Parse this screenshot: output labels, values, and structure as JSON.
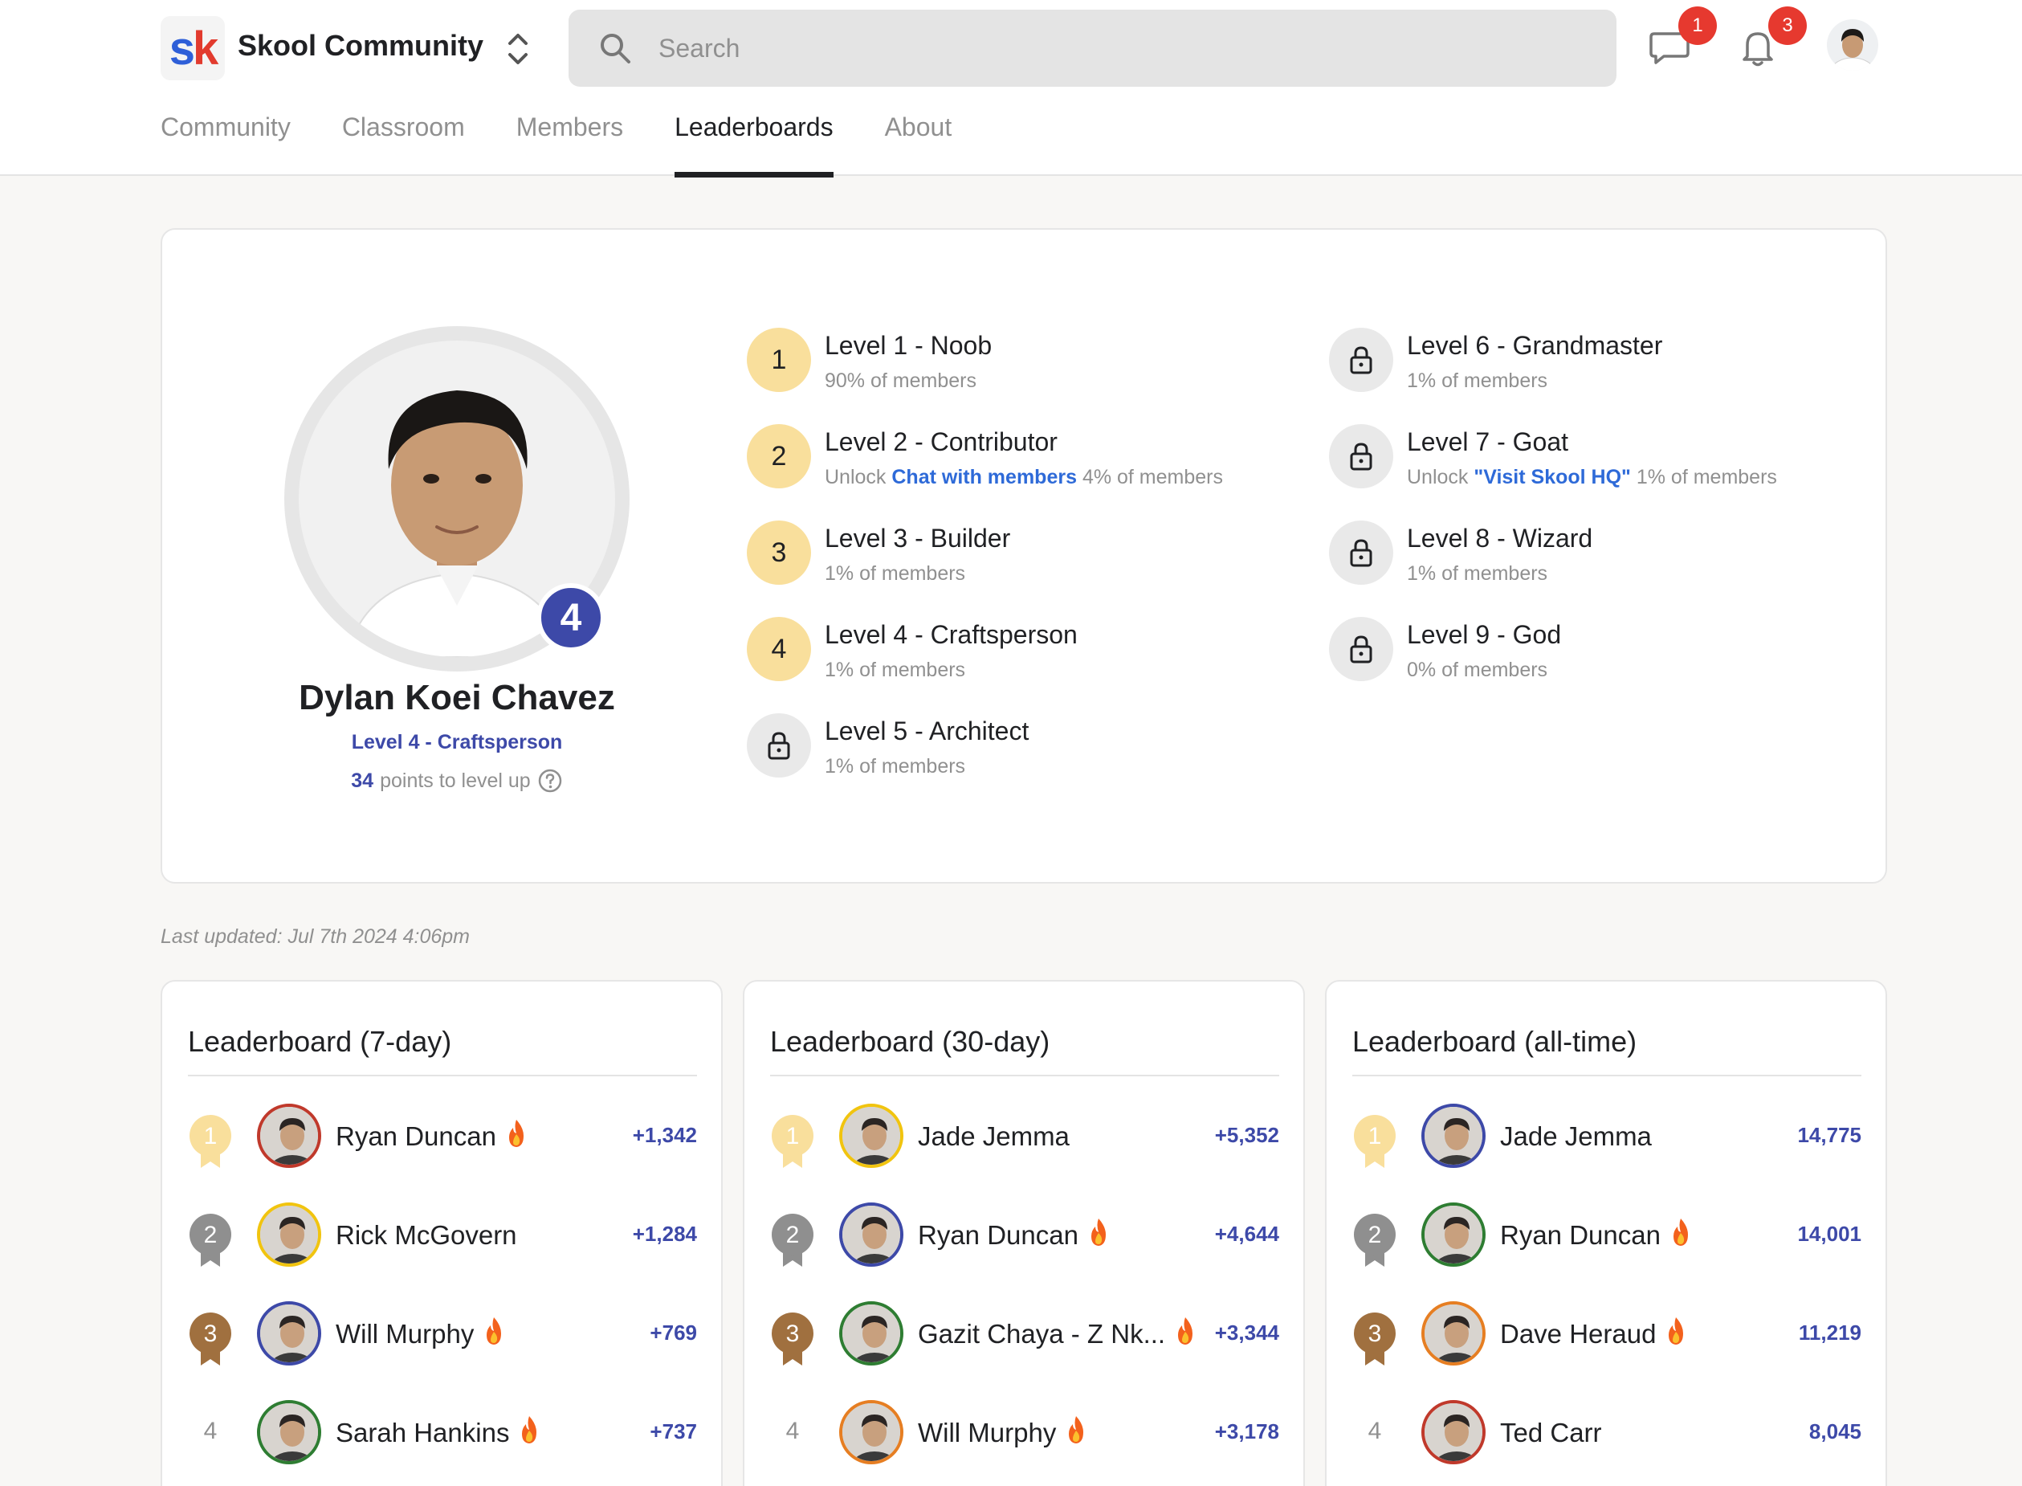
{
  "header": {
    "logo": {
      "s": "s",
      "k": "k"
    },
    "community_name": "Skool Community",
    "search_placeholder": "Search",
    "chat_badge": "1",
    "notif_badge": "3"
  },
  "tabs": [
    {
      "label": "Community"
    },
    {
      "label": "Classroom"
    },
    {
      "label": "Members"
    },
    {
      "label": "Leaderboards"
    },
    {
      "label": "About"
    }
  ],
  "profile": {
    "level_badge": "4",
    "name": "Dylan Koei Chavez",
    "level_name": "Level 4 - Craftsperson",
    "points": "34",
    "points_text": "points to level up"
  },
  "levels": [
    {
      "badge": "1",
      "title": "Level 1 - Noob",
      "sub": "90% of members"
    },
    {
      "badge": "2",
      "title": "Level 2 - Contributor",
      "unlock_prefix": "Unlock ",
      "unlock_link": "Chat with members",
      "sub": "4% of members"
    },
    {
      "badge": "3",
      "title": "Level 3 - Builder",
      "sub": "1% of members"
    },
    {
      "badge": "4",
      "title": "Level 4 - Craftsperson",
      "sub": "1% of members"
    },
    {
      "badge": "lock",
      "title": "Level 5 - Architect",
      "sub": "1% of members"
    },
    {
      "badge": "lock",
      "title": "Level 6 - Grandmaster",
      "sub": "1% of members"
    },
    {
      "badge": "lock",
      "title": "Level 7 - Goat",
      "unlock_prefix": "Unlock ",
      "unlock_link": "\"Visit Skool HQ\"",
      "sub": "1% of members"
    },
    {
      "badge": "lock",
      "title": "Level 8 - Wizard",
      "sub": "1% of members"
    },
    {
      "badge": "lock",
      "title": "Level 9 - God",
      "sub": "0% of members"
    }
  ],
  "last_updated": "Last updated: Jul 7th 2024 4:06pm",
  "leaderboards": [
    {
      "title": "Leaderboard (7-day)",
      "rows": [
        {
          "rank": "1",
          "name": "Ryan Duncan",
          "fire": true,
          "points": "+1,342"
        },
        {
          "rank": "2",
          "name": "Rick McGovern",
          "fire": false,
          "points": "+1,284"
        },
        {
          "rank": "3",
          "name": "Will Murphy",
          "fire": true,
          "points": "+769"
        },
        {
          "rank": "4",
          "name": "Sarah Hankins",
          "fire": true,
          "points": "+737"
        }
      ]
    },
    {
      "title": "Leaderboard (30-day)",
      "rows": [
        {
          "rank": "1",
          "name": "Jade Jemma",
          "fire": false,
          "points": "+5,352"
        },
        {
          "rank": "2",
          "name": "Ryan Duncan",
          "fire": true,
          "points": "+4,644"
        },
        {
          "rank": "3",
          "name": "Gazit Chaya - Z Nk...",
          "fire": true,
          "points": "+3,344"
        },
        {
          "rank": "4",
          "name": "Will Murphy",
          "fire": true,
          "points": "+3,178"
        }
      ]
    },
    {
      "title": "Leaderboard (all-time)",
      "rows": [
        {
          "rank": "1",
          "name": "Jade Jemma",
          "fire": false,
          "points": "14,775"
        },
        {
          "rank": "2",
          "name": "Ryan Duncan",
          "fire": true,
          "points": "14,001"
        },
        {
          "rank": "3",
          "name": "Dave Heraud",
          "fire": true,
          "points": "11,219"
        },
        {
          "rank": "4",
          "name": "Ted Carr",
          "fire": false,
          "points": "8,045"
        }
      ]
    }
  ],
  "colors": {
    "accent": "#3d49a8",
    "link": "#2e6ad8",
    "gold": "#f9df9c",
    "silver": "#8f8f8f",
    "bronze": "#a0703f",
    "badge_red": "#e6392f"
  }
}
